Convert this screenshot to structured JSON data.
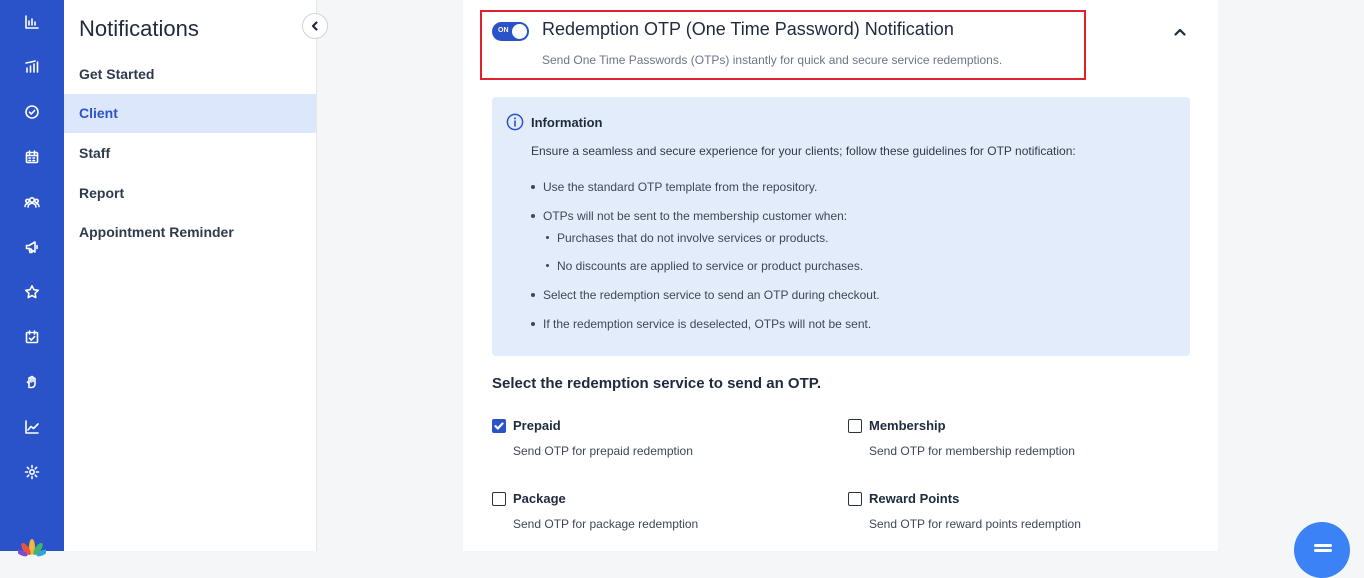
{
  "rail": {
    "icons": [
      "dashboard-icon",
      "bar-chart-icon",
      "check-circle-icon",
      "calendar-icon",
      "users-icon",
      "megaphone-icon",
      "star-icon",
      "calendar-check-icon",
      "hand-icon",
      "trend-icon",
      "gear-icon"
    ]
  },
  "panel": {
    "title": "Notifications",
    "items": [
      {
        "label": "Get Started"
      },
      {
        "label": "Client"
      },
      {
        "label": "Staff"
      },
      {
        "label": "Report"
      },
      {
        "label": "Appointment Reminder"
      }
    ],
    "active_index": 1
  },
  "section": {
    "toggle_label": "ON",
    "title": "Redemption OTP (One Time Password) Notification",
    "subtitle": "Send One Time Passwords (OTPs) instantly for quick and secure service redemptions."
  },
  "info": {
    "title": "Information",
    "lead": "Ensure a seamless and secure experience for your clients; follow these guidelines for OTP notification:",
    "bullets": [
      "Use the standard OTP template from the repository.",
      "OTPs will not be sent to the membership customer when:",
      "Purchases that do not involve services or products.",
      "No discounts are applied to service or product purchases.",
      "Select the redemption service to send an OTP during checkout.",
      "If the redemption service is deselected, OTPs will not be sent."
    ]
  },
  "services": {
    "title": "Select the redemption service to send an OTP.",
    "options": [
      {
        "label": "Prepaid",
        "desc": "Send OTP for prepaid redemption",
        "checked": true
      },
      {
        "label": "Membership",
        "desc": "Send OTP for membership redemption",
        "checked": false
      },
      {
        "label": "Package",
        "desc": "Send OTP for package redemption",
        "checked": false
      },
      {
        "label": "Reward Points",
        "desc": "Send OTP for reward points redemption",
        "checked": false
      }
    ]
  },
  "colors": {
    "accent": "#2a53c9",
    "highlight": "#e0202a",
    "info_bg": "#e3ecfb"
  }
}
